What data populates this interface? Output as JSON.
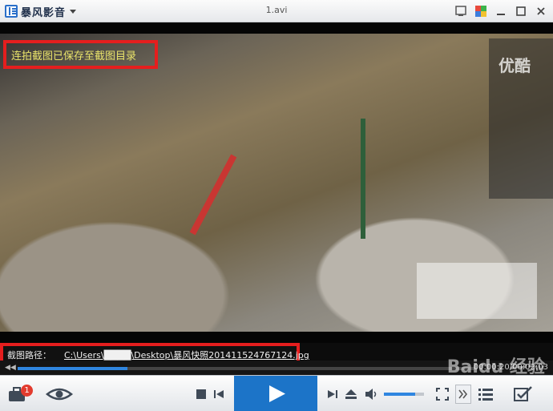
{
  "window": {
    "app_name": "暴风影音",
    "file_title": "1.avi"
  },
  "video": {
    "watermark": "优酷",
    "capture_notice": "连拍截图已保存至截图目录"
  },
  "capture_path": {
    "label": "截图路径：",
    "path": "C:\\Users\\████\\Desktop\\暴风快照201411524767124.jpg"
  },
  "playback": {
    "elapsed": "00:00:20",
    "total": "00:02:03",
    "time_text": "00:00:20/00:02:03",
    "progress": 0.24
  },
  "controls": {
    "notification_count": "1",
    "volume": 0.78
  },
  "overlay": {
    "baidu_watermark": "Baidu 经验"
  },
  "colors": {
    "accent": "#1c74c8",
    "highlight_box": "#e51e1e",
    "notice_text": "#e9e36a"
  }
}
